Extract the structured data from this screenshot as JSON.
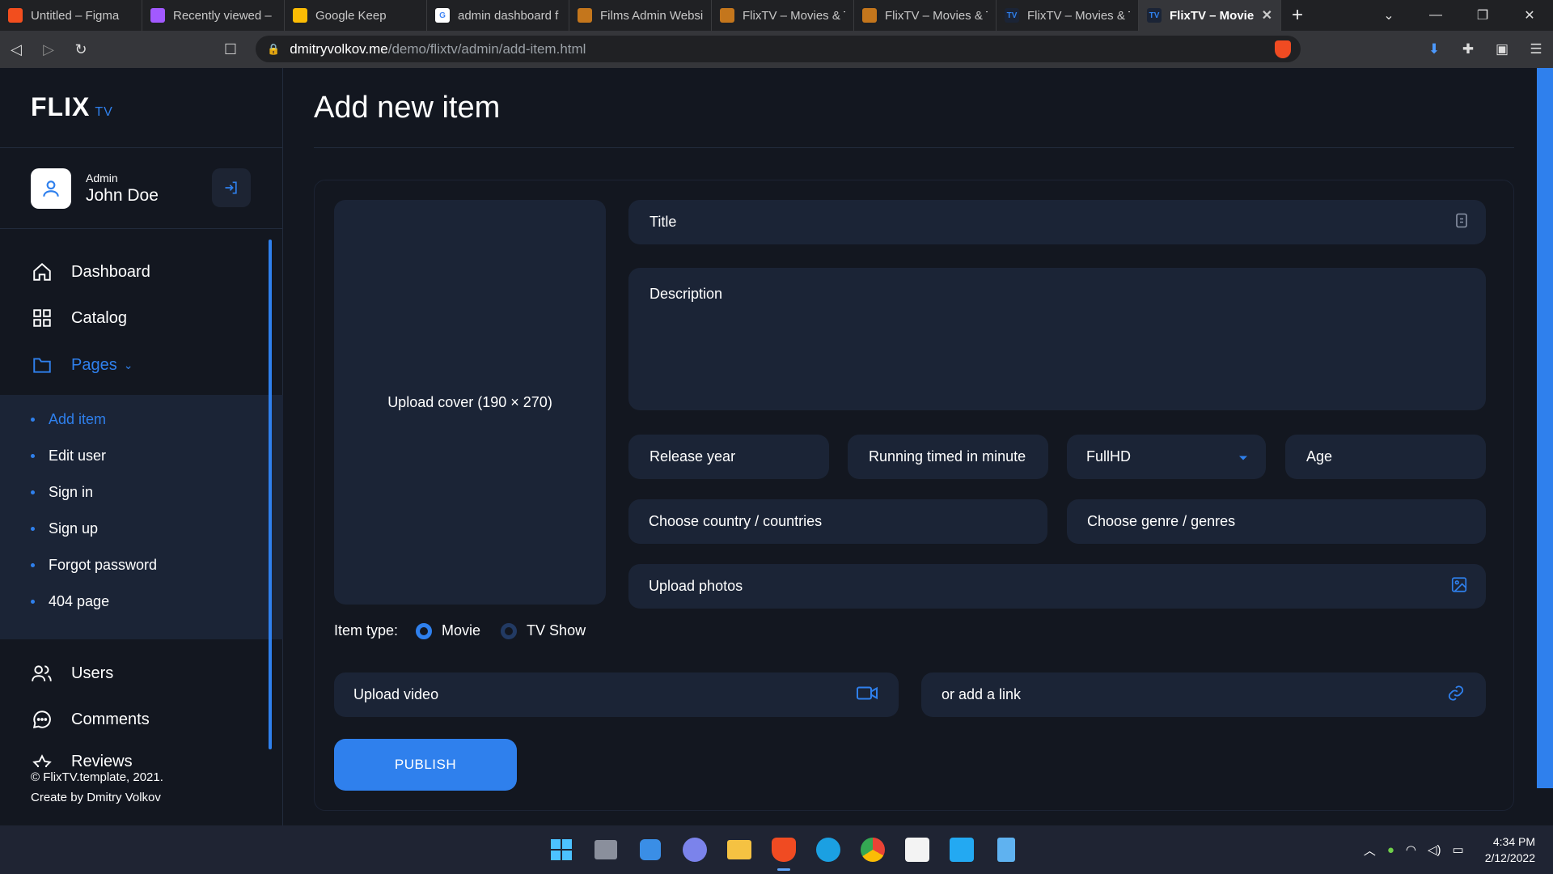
{
  "browser": {
    "tabs": [
      {
        "label": "Untitled – Figma",
        "icon": "figma-icon",
        "color": "#f24e1e"
      },
      {
        "label": "Recently viewed – F",
        "icon": "figma-icon",
        "color": "#a259ff"
      },
      {
        "label": "Google Keep",
        "icon": "keep-icon",
        "color": "#fbbc04"
      },
      {
        "label": "admin dashboard f",
        "icon": "google-icon",
        "color": "#4285f4"
      },
      {
        "label": "Films Admin Websit",
        "icon": "bookmark-icon",
        "color": "#c4761c"
      },
      {
        "label": "FlixTV – Movies & T",
        "icon": "bookmark-icon",
        "color": "#c4761c"
      },
      {
        "label": "FlixTV – Movies & T",
        "icon": "bookmark-icon",
        "color": "#c4761c"
      },
      {
        "label": "FlixTV – Movies & T",
        "icon": "flixtv-icon",
        "color": "#2f80ed"
      },
      {
        "label": "FlixTV – Movie",
        "icon": "flixtv-icon",
        "color": "#2f80ed"
      }
    ],
    "url_host": "dmitryvolkov.me",
    "url_path": "/demo/flixtv/admin/add-item.html"
  },
  "sidebar": {
    "logo": "FLIX",
    "logo_suffix": "TV",
    "user_role": "Admin",
    "user_name": "John Doe",
    "nav": [
      {
        "label": "Dashboard",
        "icon": "home-icon"
      },
      {
        "label": "Catalog",
        "icon": "grid-icon"
      },
      {
        "label": "Pages",
        "icon": "folder-icon"
      },
      {
        "label": "Users",
        "icon": "users-icon"
      },
      {
        "label": "Comments",
        "icon": "chat-icon"
      },
      {
        "label": "Reviews",
        "icon": "star-icon"
      }
    ],
    "pages_caret": "⌄",
    "submenu": [
      "Add item",
      "Edit user",
      "Sign in",
      "Sign up",
      "Forgot password",
      "404 page"
    ],
    "footer_line1": "© FlixTV.template, 2021.",
    "footer_line2_prefix": "Create by",
    "footer_author": "Dmitry Volkov"
  },
  "main": {
    "title": "Add new item",
    "cover_label": "Upload cover (190 × 270)",
    "title_placeholder": "Title",
    "description_placeholder": "Description",
    "release_year": "Release year",
    "running_time": "Running timed in minute",
    "quality_value": "FullHD",
    "age": "Age",
    "country": "Choose country / countries",
    "genre": "Choose genre / genres",
    "upload_photos": "Upload photos",
    "item_type_label": "Item type:",
    "item_type_options": [
      "Movie",
      "TV Show"
    ],
    "upload_video": "Upload video",
    "add_link": "or add a link",
    "publish": "PUBLISH"
  },
  "taskbar": {
    "time": "4:34 PM",
    "date": "2/12/2022"
  },
  "colors": {
    "accent": "#2f80ed",
    "background": "#131720",
    "field": "#1b2436"
  }
}
